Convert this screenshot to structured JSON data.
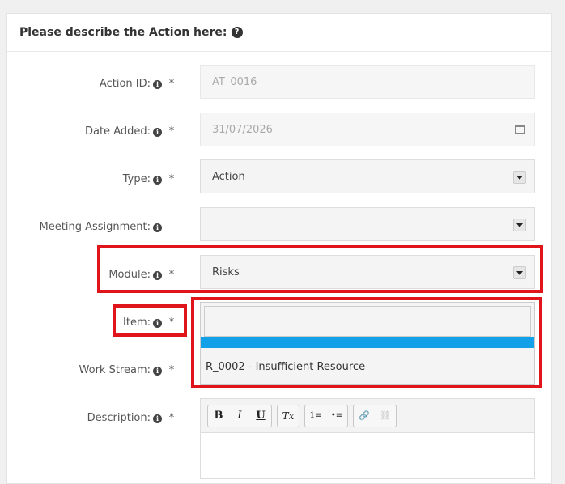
{
  "panel": {
    "title": "Please describe the Action here:",
    "help_icon": "question-circle-icon"
  },
  "required_mark": "*",
  "info_icon": "i",
  "fields": {
    "action_id": {
      "label": "Action ID:",
      "value": "AT_0016"
    },
    "date_added": {
      "label": "Date Added:",
      "value": "31/07/2026",
      "icon": "calendar-icon"
    },
    "type": {
      "label": "Type:",
      "value": "Action"
    },
    "meeting_assignment": {
      "label": "Meeting Assignment:",
      "value": ""
    },
    "module": {
      "label": "Module:",
      "value": "Risks"
    },
    "item": {
      "label": "Item:",
      "search_value": "",
      "options": [
        "R_0002 - Insufficient Resource"
      ]
    },
    "work_stream": {
      "label": "Work Stream:"
    },
    "description": {
      "label": "Description:"
    }
  },
  "toolbar": {
    "bold": "B",
    "italic": "I",
    "underline": "U",
    "clear_format": "Tx",
    "ordered_list": "1≡",
    "bullet_list": "•≡",
    "link": "🔗",
    "unlink": "⛓"
  },
  "colors": {
    "highlight": "#12a0e8",
    "annotation": "#e0151b"
  }
}
